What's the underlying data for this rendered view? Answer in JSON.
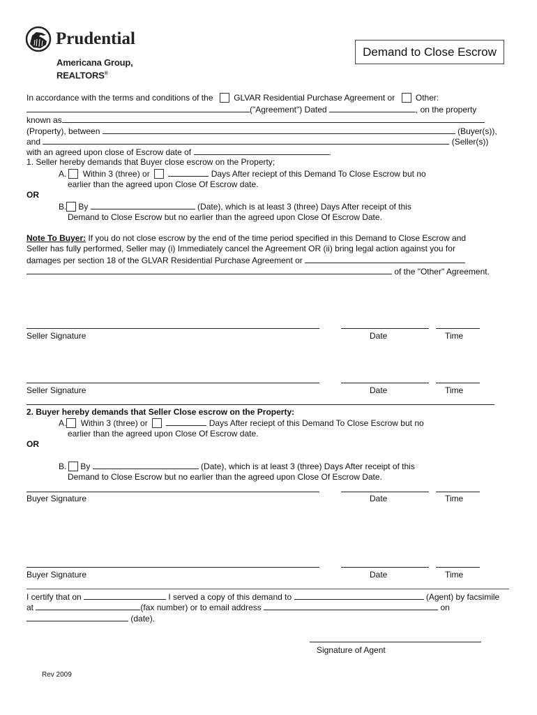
{
  "header": {
    "logo": {
      "icon": "rock-of-gibraltar-icon",
      "company": "Prudential",
      "office_line1": "Americana Group,",
      "office_line2": "REALTORS",
      "registered_mark": "®"
    },
    "title": "Demand to Close Escrow"
  },
  "intro": {
    "l1_text": "In accordance with the terms and conditions of the",
    "glvar_option": "GLVAR Residential Purchase Agreement or",
    "other_option": "Other:",
    "l2_mid": "(\"Agreement\") Dated",
    "l2_end": ", on the property",
    "l3_text": "known as",
    "l4_start": "(Property), between",
    "l4_end": "(Buyer(s)),",
    "l5_start": "and",
    "l5_end": "(Seller(s))",
    "l6_text": "with an agreed upon close of Escrow date of",
    "l6_end": "."
  },
  "section1": {
    "heading": "1. Seller hereby demands that Buyer close escrow on the Property;",
    "a_label": "A.",
    "a_within": "Within 3 (three) or",
    "a_days": "Days After reciept of this Demand To Close Escrow but no",
    "a_line2": "earlier than the agreed upon Close Of Escrow date.",
    "or": "OR",
    "b_label": "B.",
    "b_by": "By",
    "b_date": "(Date), which is at least 3 (three) Days After receipt of this",
    "b_line2": "Demand to Close Escrow but no earlier than the agreed upon Close Of Escrow Date."
  },
  "note": {
    "label": "Note To Buyer:",
    "l1": " If you do not close escrow by the end of the time period specified in this Demand to Close Escrow and",
    "l2": "Seller has fully performed, Seller may (i) Immediately cancel the Agreement OR (ii) bring legal action against you for",
    "l3": "damages per section 18 of the GLVAR Residential Purchase Agreement or",
    "l4_end": "of the \"Other\" Agreement."
  },
  "seller_signatures": [
    {
      "signature_label": "Seller Signature",
      "date_label": "Date",
      "time_label": "Time"
    },
    {
      "signature_label": "Seller Signature",
      "date_label": "Date",
      "time_label": "Time"
    }
  ],
  "section2": {
    "heading": "2. Buyer hereby demands that Seller Close escrow on the Property:",
    "a_label": "A.",
    "a_within": "Within 3 (three) or",
    "a_days": "Days After reciept of this Demand To Close Escrow but no",
    "a_line2": "earlier than the agreed upon Close Of Escrow date.",
    "or": "OR",
    "b_label": "B.",
    "b_by": "By",
    "b_date": "(Date), which is at least 3 (three) Days After receipt of this",
    "b_line2": "Demand to Close Escrow but no earlier than the agreed upon Close Of Escrow Date."
  },
  "buyer_signatures": [
    {
      "signature_label": "Buyer Signature",
      "date_label": "Date",
      "time_label": "Time"
    },
    {
      "signature_label": "Buyer Signature",
      "date_label": "Date",
      "time_label": "Time"
    }
  ],
  "certification": {
    "l1_start": "I certify that on",
    "l1_mid": "I served a copy of this demand to",
    "l1_end": "(Agent) by facsimile",
    "l2_start": "at",
    "l2_mid": "(fax number) or to email address",
    "l2_end": "on",
    "l3_end": "(date).",
    "agent_signature_label": "Signature of Agent"
  },
  "footer": {
    "revision": "Rev 2009"
  }
}
